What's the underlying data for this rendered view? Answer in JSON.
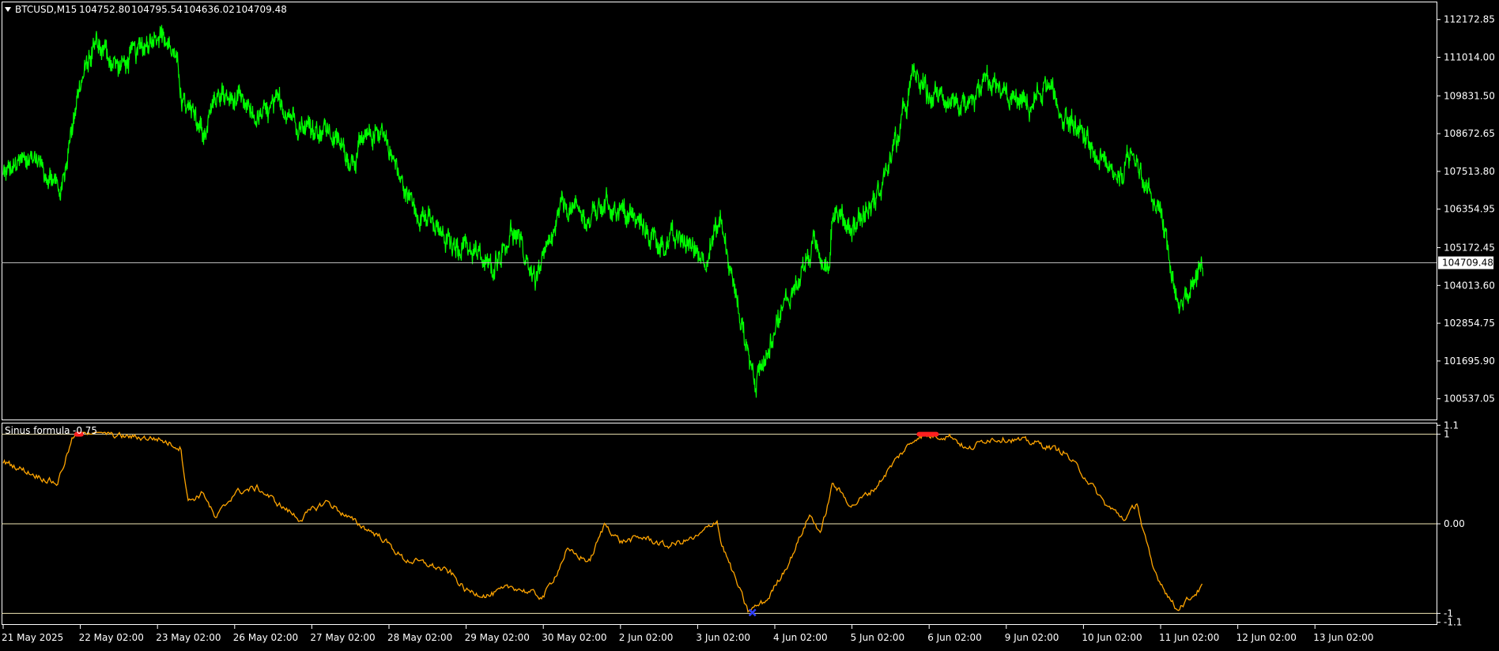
{
  "header": {
    "symbol": "BTCUSD,M15",
    "open": "104752.80",
    "high": "104795.54",
    "low": "104636.02",
    "close": "104709.48"
  },
  "indicator": {
    "name": "Sinus formula",
    "value": "-0.75"
  },
  "colors": {
    "background": "#000000",
    "frame": "#ffffff",
    "price_line": "#00ff00",
    "indicator_line": "#ffa500",
    "signal_high": "#ff2020",
    "signal_low": "#3040ff",
    "level_line": "#f0e6b4",
    "current_price_line": "#c0c0c0"
  },
  "chart_data": [
    {
      "type": "line",
      "panel": "price",
      "series": [],
      "x": [
        "21 May 2025",
        "22 May 02:00",
        "23 May 02:00",
        "26 May 02:00",
        "27 May 02:00",
        "28 May 02:00",
        "29 May 02:00",
        "30 May 02:00",
        "2 Jun 02:00",
        "3 Jun 02:00",
        "4 Jun 02:00",
        "5 Jun 02:00",
        "6 Jun 02:00",
        "9 Jun 02:00",
        "10 Jun 02:00",
        "11 Jun 02:00",
        "12 Jun 02:00",
        "13 Jun 02:00"
      ],
      "anchors": [
        [
          0,
          107400
        ],
        [
          0.4,
          108000
        ],
        [
          0.75,
          106900
        ],
        [
          0.95,
          109800
        ],
        [
          1.2,
          111500
        ],
        [
          1.5,
          110700
        ],
        [
          1.8,
          111300
        ],
        [
          2.0,
          111900
        ],
        [
          2.2,
          111200
        ],
        [
          2.35,
          109500
        ],
        [
          2.6,
          108700
        ],
        [
          2.75,
          109800
        ],
        [
          3.0,
          109700
        ],
        [
          3.3,
          109100
        ],
        [
          3.6,
          109600
        ],
        [
          3.9,
          108900
        ],
        [
          4.2,
          108800
        ],
        [
          4.5,
          107900
        ],
        [
          4.9,
          108900
        ],
        [
          5.2,
          106900
        ],
        [
          5.5,
          106000
        ],
        [
          5.8,
          105200
        ],
        [
          6.0,
          105300
        ],
        [
          6.3,
          104500
        ],
        [
          6.6,
          105700
        ],
        [
          6.9,
          104200
        ],
        [
          7.1,
          105300
        ],
        [
          7.25,
          106500
        ],
        [
          7.6,
          106000
        ],
        [
          7.8,
          106600
        ],
        [
          8.2,
          106000
        ],
        [
          8.5,
          105300
        ],
        [
          8.8,
          105400
        ],
        [
          9.1,
          104900
        ],
        [
          9.3,
          106000
        ],
        [
          9.4,
          104700
        ],
        [
          9.6,
          102500
        ],
        [
          9.75,
          101000
        ],
        [
          10.0,
          102800
        ],
        [
          10.3,
          104200
        ],
        [
          10.5,
          105200
        ],
        [
          10.7,
          104700
        ],
        [
          10.75,
          106300
        ],
        [
          11.0,
          105800
        ],
        [
          11.3,
          106600
        ],
        [
          11.6,
          108600
        ],
        [
          11.8,
          110500
        ],
        [
          12.0,
          109800
        ],
        [
          12.3,
          109800
        ],
        [
          12.5,
          109200
        ],
        [
          12.75,
          110300
        ],
        [
          13.0,
          109800
        ],
        [
          13.3,
          109500
        ],
        [
          13.5,
          110100
        ],
        [
          13.75,
          109200
        ],
        [
          14.0,
          108500
        ],
        [
          14.3,
          107600
        ],
        [
          14.5,
          107400
        ],
        [
          14.65,
          108300
        ],
        [
          14.8,
          107000
        ],
        [
          15.0,
          106400
        ],
        [
          15.15,
          104200
        ],
        [
          15.25,
          103100
        ],
        [
          15.45,
          104300
        ],
        [
          15.55,
          104700
        ]
      ],
      "ylim": [
        99900,
        112700
      ],
      "yticks": [
        "112172.85",
        "111014.00",
        "109831.50",
        "108672.65",
        "107513.80",
        "106354.95",
        "105172.45",
        "104013.60",
        "102854.75",
        "101695.90",
        "100537.05"
      ],
      "current_price": "104709.48",
      "current_price_value": 104709.48,
      "grid": false
    },
    {
      "type": "line",
      "panel": "indicator",
      "name": "Sinus formula",
      "series": [],
      "anchors": [
        [
          0,
          0.7
        ],
        [
          0.4,
          0.55
        ],
        [
          0.7,
          0.45
        ],
        [
          0.9,
          0.95
        ],
        [
          1.0,
          1.05
        ],
        [
          1.5,
          0.98
        ],
        [
          2.0,
          0.95
        ],
        [
          2.3,
          0.85
        ],
        [
          2.4,
          0.25
        ],
        [
          2.6,
          0.35
        ],
        [
          2.75,
          0.05
        ],
        [
          3.0,
          0.35
        ],
        [
          3.3,
          0.4
        ],
        [
          3.6,
          0.2
        ],
        [
          3.85,
          0.05
        ],
        [
          4.0,
          0.15
        ],
        [
          4.2,
          0.25
        ],
        [
          4.5,
          0.05
        ],
        [
          4.9,
          -0.15
        ],
        [
          5.2,
          -0.4
        ],
        [
          5.5,
          -0.45
        ],
        [
          5.8,
          -0.55
        ],
        [
          6.0,
          -0.75
        ],
        [
          6.3,
          -0.8
        ],
        [
          6.6,
          -0.7
        ],
        [
          7.0,
          -0.82
        ],
        [
          7.2,
          -0.5
        ],
        [
          7.3,
          -0.3
        ],
        [
          7.6,
          -0.42
        ],
        [
          7.8,
          0.0
        ],
        [
          8.0,
          -0.2
        ],
        [
          8.3,
          -0.15
        ],
        [
          8.6,
          -0.25
        ],
        [
          8.8,
          -0.2
        ],
        [
          9.0,
          -0.15
        ],
        [
          9.25,
          0.05
        ],
        [
          9.3,
          -0.2
        ],
        [
          9.55,
          -0.75
        ],
        [
          9.65,
          -0.98
        ],
        [
          9.9,
          -0.85
        ],
        [
          10.2,
          -0.4
        ],
        [
          10.35,
          -0.1
        ],
        [
          10.45,
          0.1
        ],
        [
          10.6,
          -0.1
        ],
        [
          10.75,
          0.45
        ],
        [
          11.0,
          0.2
        ],
        [
          11.3,
          0.4
        ],
        [
          11.6,
          0.75
        ],
        [
          11.85,
          0.98
        ],
        [
          12.3,
          0.98
        ],
        [
          12.5,
          0.82
        ],
        [
          12.75,
          0.95
        ],
        [
          13.0,
          0.95
        ],
        [
          13.4,
          0.9
        ],
        [
          13.75,
          0.8
        ],
        [
          14.0,
          0.55
        ],
        [
          14.3,
          0.2
        ],
        [
          14.55,
          0.05
        ],
        [
          14.7,
          0.25
        ],
        [
          14.75,
          0.0
        ],
        [
          14.9,
          -0.5
        ],
        [
          15.1,
          -0.8
        ],
        [
          15.2,
          -0.95
        ],
        [
          15.35,
          -0.85
        ],
        [
          15.55,
          -0.7
        ]
      ],
      "levels": [
        1.0,
        0.0,
        -1.0
      ],
      "ylim": [
        -1.12,
        1.12
      ],
      "yticks": [
        "1.1",
        "1",
        "0.00",
        "-1",
        "-1.1"
      ],
      "grid": false,
      "signals_high": [
        0.9,
        11.9
      ],
      "signals_low": [
        9.7
      ]
    }
  ]
}
